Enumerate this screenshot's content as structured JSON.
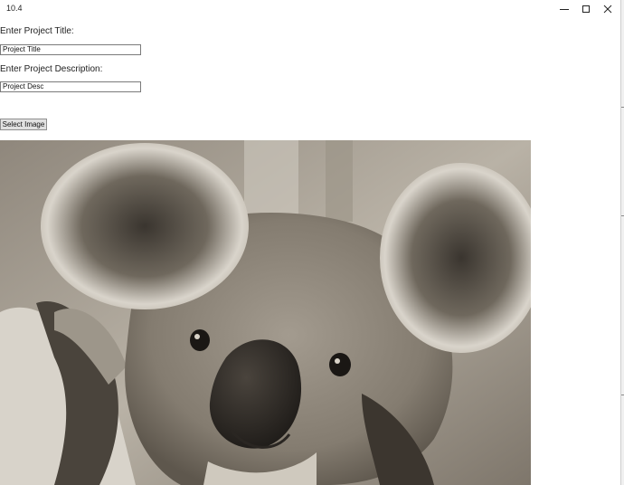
{
  "window": {
    "title": "10.4",
    "controls": {
      "minimize": "minimize-icon",
      "maximize": "maximize-icon",
      "close": "close-icon"
    }
  },
  "form": {
    "title_label": "Enter Project Title:",
    "title_value": "Project Title",
    "desc_label": "Enter Project Description:",
    "desc_value": "Project Desc",
    "select_button": "Select Image"
  },
  "image": {
    "subject": "koala",
    "tone": "sepia"
  },
  "colors": {
    "window_bg": "#ffffff",
    "button_bg": "#e1e1e1",
    "input_border": "#7a7a7a"
  }
}
